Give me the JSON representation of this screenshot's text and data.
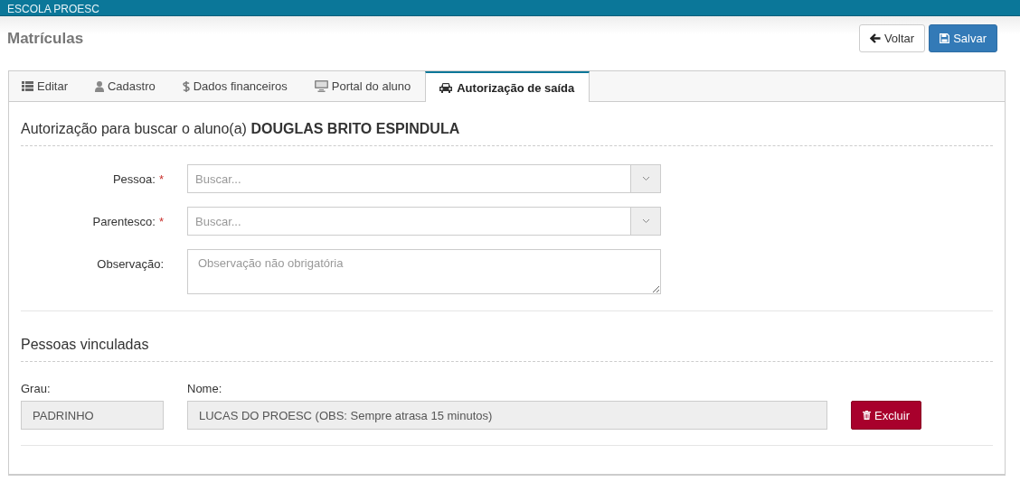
{
  "header": {
    "brand": "ESCOLA PROESC"
  },
  "page": {
    "title": "Matrículas"
  },
  "actions": [
    {
      "kind": "back",
      "label": "Voltar"
    },
    {
      "kind": "save",
      "label": "Salvar"
    }
  ],
  "tabs": [
    {
      "label": "Editar",
      "selected": false
    },
    {
      "label": "Cadastro",
      "selected": false
    },
    {
      "label": "Dados financeiros",
      "selected": false
    },
    {
      "label": "Portal do aluno",
      "selected": false
    },
    {
      "label": "Autorização de saída",
      "selected": true
    }
  ],
  "form": {
    "heading": "Autorização para buscar o aluno(a) **DOUGLAS BRITO ESPINDULA**",
    "fields": [
      {
        "kind": "select",
        "label": "Pessoa:",
        "required_mark": "*",
        "placeholder": "Buscar..."
      },
      {
        "kind": "select",
        "label": "Parentesco:",
        "required_mark": "*",
        "placeholder": "Buscar..."
      },
      {
        "kind": "textarea",
        "label": "Observação:",
        "placeholder": "Observação não obrigatória"
      }
    ]
  },
  "linked": {
    "heading": "Pessoas vinculadas",
    "grau_label": "Grau:",
    "nome_label": "Nome:",
    "rows": [
      {
        "grau": "PADRINHO",
        "nome": "LUCAS DO PROESC (OBS: Sempre atrasa 15 minutos)",
        "button": "Excluir"
      }
    ]
  }
}
